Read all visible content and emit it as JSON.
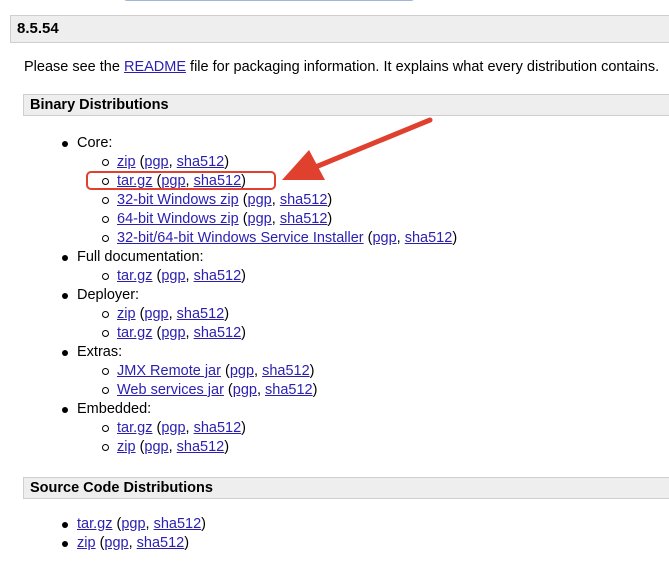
{
  "version": "8.5.54",
  "intro": {
    "before": "Please see the ",
    "link": "README",
    "after": " file for packaging information. It explains what every distribution contains."
  },
  "binary": {
    "title": "Binary Distributions",
    "groups": [
      {
        "label": "Core:",
        "items": [
          {
            "name": "zip",
            "pgp": "pgp",
            "sha": "sha512"
          },
          {
            "name": "tar.gz",
            "pgp": "pgp",
            "sha": "sha512"
          },
          {
            "name": "32-bit Windows zip",
            "pgp": "pgp",
            "sha": "sha512"
          },
          {
            "name": "64-bit Windows zip",
            "pgp": "pgp",
            "sha": "sha512"
          },
          {
            "name": "32-bit/64-bit Windows Service Installer",
            "pgp": "pgp",
            "sha": "sha512"
          }
        ]
      },
      {
        "label": "Full documentation:",
        "items": [
          {
            "name": "tar.gz",
            "pgp": "pgp",
            "sha": "sha512"
          }
        ]
      },
      {
        "label": "Deployer:",
        "items": [
          {
            "name": "zip",
            "pgp": "pgp",
            "sha": "sha512"
          },
          {
            "name": "tar.gz",
            "pgp": "pgp",
            "sha": "sha512"
          }
        ]
      },
      {
        "label": "Extras:",
        "items": [
          {
            "name": "JMX Remote jar",
            "pgp": "pgp",
            "sha": "sha512"
          },
          {
            "name": "Web services jar",
            "pgp": "pgp",
            "sha": "sha512"
          }
        ]
      },
      {
        "label": "Embedded:",
        "items": [
          {
            "name": "tar.gz",
            "pgp": "pgp",
            "sha": "sha512"
          },
          {
            "name": "zip",
            "pgp": "pgp",
            "sha": "sha512"
          }
        ]
      }
    ]
  },
  "source": {
    "title": "Source Code Distributions",
    "items": [
      {
        "name": "tar.gz",
        "pgp": "pgp",
        "sha": "sha512"
      },
      {
        "name": "zip",
        "pgp": "pgp",
        "sha": "sha512"
      }
    ]
  },
  "colors": {
    "annotation": "#e0402e",
    "link": "#2a1fb0"
  }
}
